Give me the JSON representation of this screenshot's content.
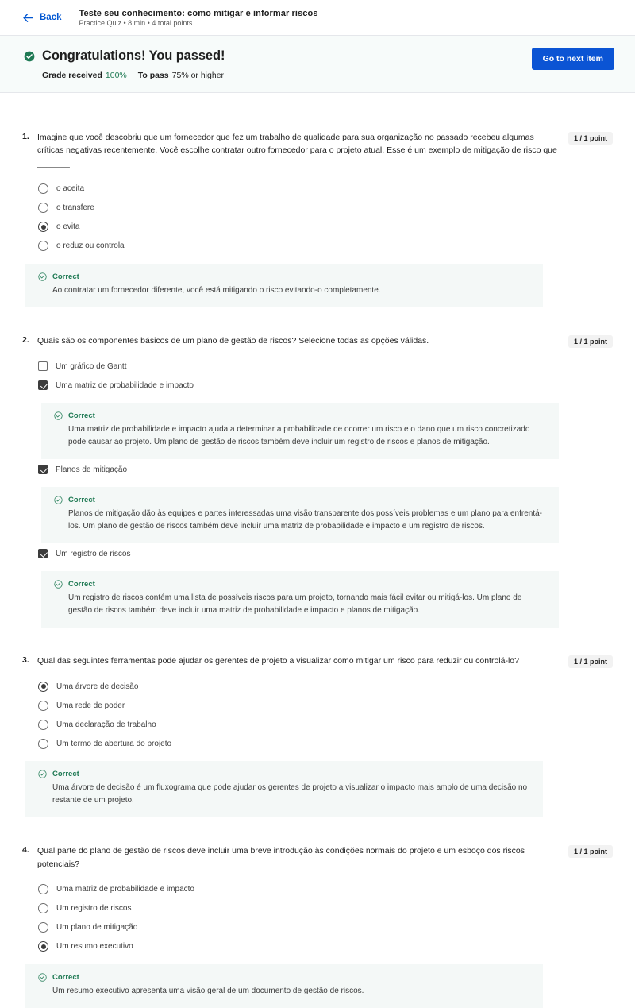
{
  "topbar": {
    "back_label": "Back",
    "quiz_title": "Teste seu conhecimento: como mitigar e informar riscos",
    "quiz_meta": "Practice Quiz • 8 min • 4 total points"
  },
  "banner": {
    "title": "Congratulations! You passed!",
    "grade_label": "Grade received",
    "grade_value": "100%",
    "pass_label": "To pass",
    "pass_value": "75% or higher",
    "next_button": "Go to next item",
    "accent_blue": "#0b54d4",
    "success_green": "#1f7a54"
  },
  "questions": [
    {
      "number": "1.",
      "text": "Imagine que você descobriu que um fornecedor que fez um trabalho de qualidade para sua organização no passado recebeu algumas críticas negativas recentemente. Você escolhe contratar outro fornecedor para o projeto atual. Esse é um exemplo de mitigação de risco que _______",
      "points": "1 / 1 point",
      "type": "radio",
      "options": [
        {
          "label": "o aceita",
          "selected": false
        },
        {
          "label": "o transfere",
          "selected": false
        },
        {
          "label": "o evita",
          "selected": true
        },
        {
          "label": "o reduz ou controla",
          "selected": false
        }
      ],
      "feedback": {
        "title": "Correct",
        "body": "Ao contratar um fornecedor diferente, você está mitigando o risco evitando-o completamente."
      }
    },
    {
      "number": "2.",
      "text": "Quais são os componentes básicos de um plano de gestão de riscos? Selecione todas as opções válidas.",
      "points": "1 / 1 point",
      "type": "checkbox",
      "options": [
        {
          "label": "Um gráfico de Gantt",
          "selected": false,
          "feedback": null
        },
        {
          "label": "Uma matriz de probabilidade e impacto",
          "selected": true,
          "feedback": {
            "title": "Correct",
            "body": "Uma matriz de probabilidade e impacto ajuda a determinar a probabilidade de ocorrer um risco e o dano que um risco concretizado pode causar ao projeto. Um plano de gestão de riscos também deve incluir um registro de riscos e planos de mitigação."
          }
        },
        {
          "label": "Planos de mitigação",
          "selected": true,
          "feedback": {
            "title": "Correct",
            "body": "Planos de mitigação dão às equipes e partes interessadas uma visão transparente dos possíveis problemas e um plano para enfrentá-los. Um plano de gestão de riscos também deve incluir uma matriz de probabilidade e impacto e um registro de riscos."
          }
        },
        {
          "label": "Um registro de riscos",
          "selected": true,
          "feedback": {
            "title": "Correct",
            "body": "Um registro de riscos contém uma lista de possíveis riscos para um projeto, tornando mais fácil evitar ou mitigá-los. Um plano de gestão de riscos também deve incluir uma matriz de probabilidade e impacto e planos de mitigação."
          }
        }
      ],
      "feedback": null
    },
    {
      "number": "3.",
      "text": "Qual das seguintes ferramentas pode ajudar os gerentes de projeto a visualizar como mitigar um risco para reduzir ou controlá-lo?",
      "points": "1 / 1 point",
      "type": "radio",
      "options": [
        {
          "label": "Uma árvore de decisão",
          "selected": true
        },
        {
          "label": "Uma rede de poder",
          "selected": false
        },
        {
          "label": "Uma declaração de trabalho",
          "selected": false
        },
        {
          "label": "Um termo de abertura do projeto",
          "selected": false
        }
      ],
      "feedback": {
        "title": "Correct",
        "body": "Uma árvore de decisão é um fluxograma que pode ajudar os gerentes de projeto a visualizar o impacto mais amplo de uma decisão no restante de um projeto."
      }
    },
    {
      "number": "4.",
      "text": "Qual parte do plano de gestão de riscos deve incluir uma breve introdução às condições normais do projeto e um esboço dos riscos potenciais?",
      "points": "1 / 1 point",
      "type": "radio",
      "options": [
        {
          "label": "Uma matriz de probabilidade e impacto",
          "selected": false
        },
        {
          "label": "Um registro de riscos",
          "selected": false
        },
        {
          "label": "Um plano de mitigação",
          "selected": false
        },
        {
          "label": "Um resumo executivo",
          "selected": true
        }
      ],
      "feedback": {
        "title": "Correct",
        "body": "Um resumo executivo apresenta uma visão geral de um documento de gestão de riscos."
      }
    }
  ]
}
